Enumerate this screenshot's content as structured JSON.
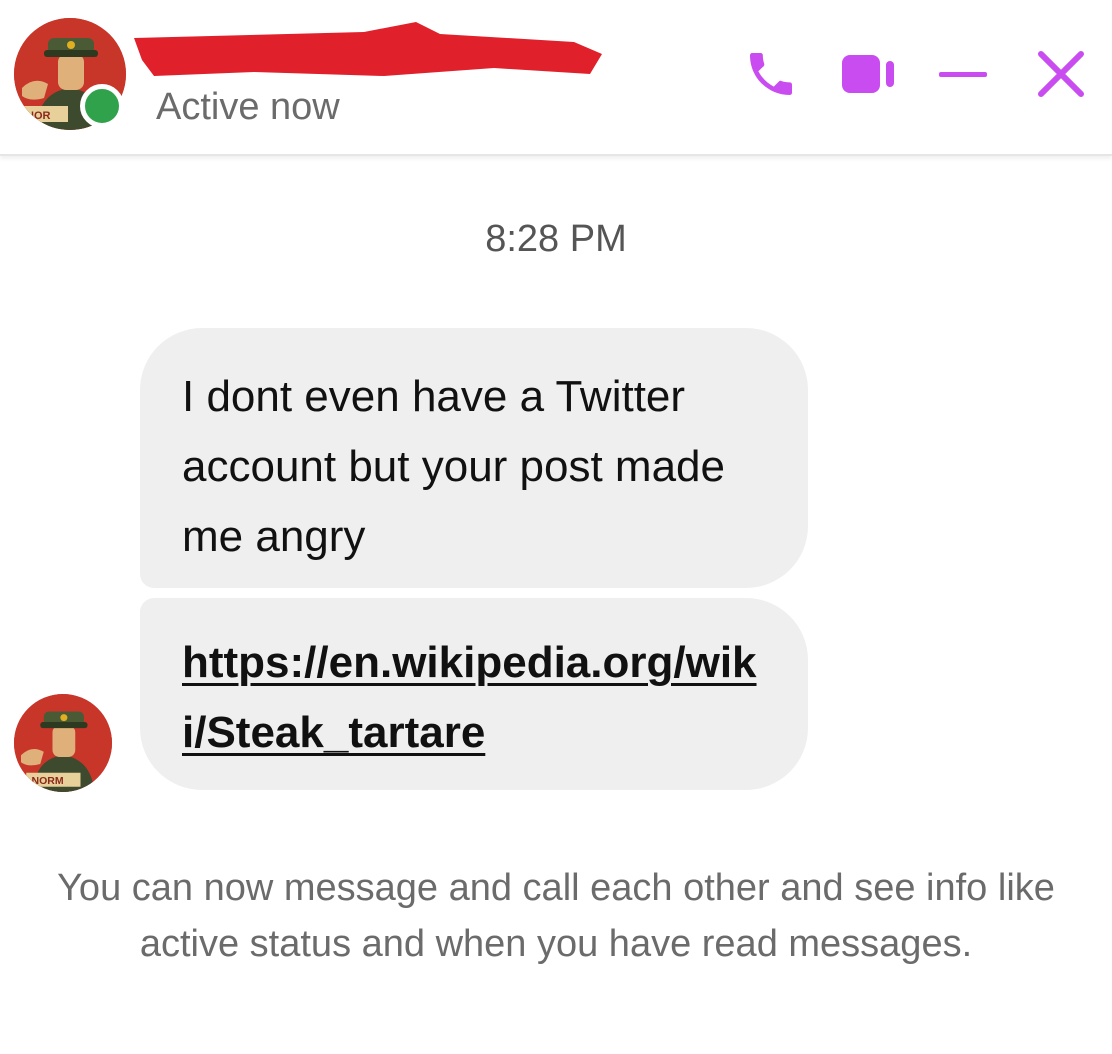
{
  "header": {
    "contact_name": "",
    "active_status": "Active now",
    "avatar_badge": "NOR",
    "icons": {
      "call": "phone-icon",
      "video": "video-camera-icon",
      "minimize": "minimize-icon",
      "close": "close-icon"
    }
  },
  "conversation": {
    "timestamp": "8:28 PM",
    "messages": [
      {
        "type": "text",
        "text": "I dont even have a Twitter account but your post made me angry"
      },
      {
        "type": "link",
        "text": "https://en.wikipedia.org/wiki/Steak_tartare"
      }
    ],
    "sender_avatar_badge": "NORM",
    "system_notice": "You can now message and call each other and see info like active status and when you have read messages."
  },
  "colors": {
    "accent": "#c94cf0",
    "bubble": "#efefef",
    "online": "#31a24c",
    "redaction": "#e0202a"
  }
}
